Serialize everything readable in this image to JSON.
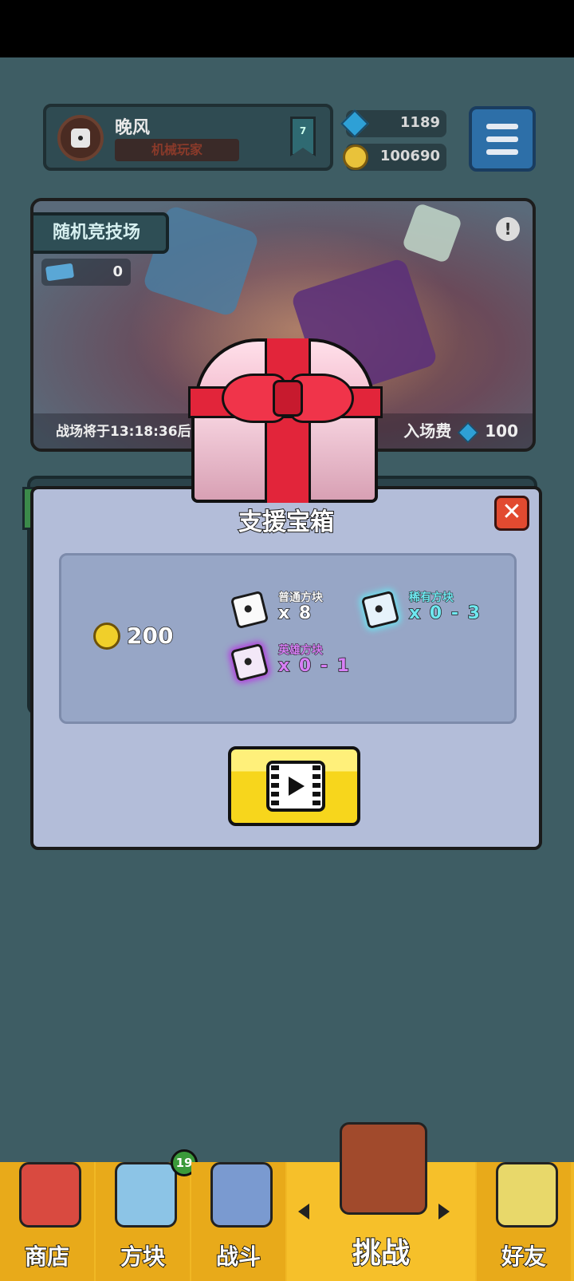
{
  "player": {
    "name": "晚风",
    "title": "机械玩家",
    "rank": "7"
  },
  "currency": {
    "gems": "1189",
    "gold": "100690"
  },
  "arena": {
    "title": "随机竞技场",
    "tickets": "0",
    "countdown": "战场将于13:18:36后",
    "entry_fee_label": "入场费",
    "entry_fee": "100"
  },
  "modal": {
    "title": "支援宝箱",
    "close_label": "✕",
    "coin_reward": "200",
    "rewards": [
      {
        "name": "普通方块",
        "qty": "x 8",
        "tier": "common"
      },
      {
        "name": "稀有方块",
        "qty": "x 0 - 3",
        "tier": "rare"
      },
      {
        "name": "英雄方块",
        "qty": "x 0 - 1",
        "tier": "hero"
      }
    ]
  },
  "nav": {
    "shop": "商店",
    "blocks": "方块",
    "blocks_badge": "19",
    "battle": "战斗",
    "challenge": "挑战",
    "friends": "好友"
  },
  "colors": {
    "nav_bg": "#f0b824",
    "modal_bg": "#b3bdd9",
    "close": "#e24a30",
    "video_button": "#f7d61c",
    "rare": "#6fe8f0",
    "hero": "#d77ff5"
  }
}
